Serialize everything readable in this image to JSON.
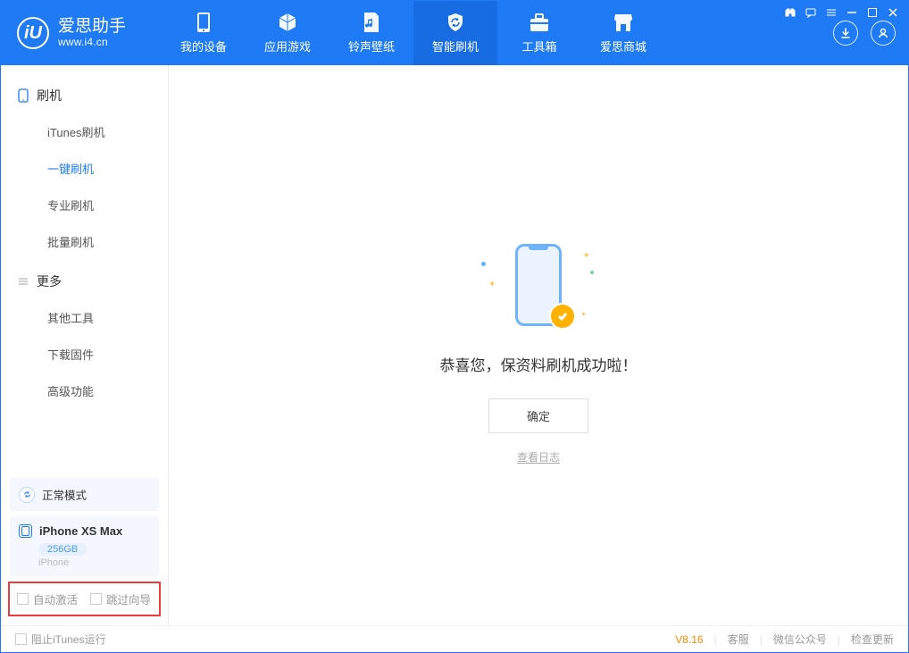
{
  "app": {
    "name": "爱思助手",
    "site": "www.i4.cn"
  },
  "nav_tabs": [
    {
      "label": "我的设备"
    },
    {
      "label": "应用游戏"
    },
    {
      "label": "铃声壁纸"
    },
    {
      "label": "智能刷机"
    },
    {
      "label": "工具箱"
    },
    {
      "label": "爱思商城"
    }
  ],
  "sidebar": {
    "section1": {
      "title": "刷机",
      "items": [
        {
          "label": "iTunes刷机"
        },
        {
          "label": "一键刷机"
        },
        {
          "label": "专业刷机"
        },
        {
          "label": "批量刷机"
        }
      ]
    },
    "section2": {
      "title": "更多",
      "items": [
        {
          "label": "其他工具"
        },
        {
          "label": "下载固件"
        },
        {
          "label": "高级功能"
        }
      ]
    },
    "mode": "正常模式",
    "device": {
      "name": "iPhone XS Max",
      "capacity": "256GB",
      "sub": "iPhone"
    },
    "opt1": "自动激活",
    "opt2": "跳过向导"
  },
  "main": {
    "result": "恭喜您，保资料刷机成功啦！",
    "ok": "确定",
    "view_log": "查看日志"
  },
  "footer": {
    "block_itunes": "阻止iTunes运行",
    "version": "V8.16",
    "cs": "客服",
    "wechat": "微信公众号",
    "update": "检查更新"
  }
}
